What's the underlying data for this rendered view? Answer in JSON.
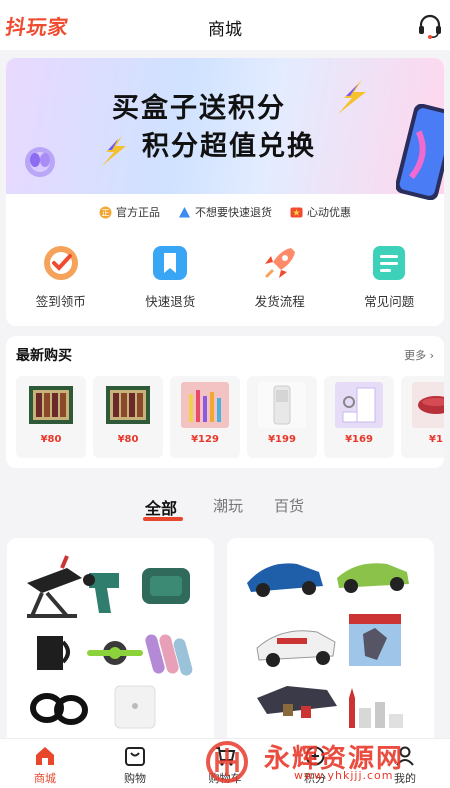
{
  "header": {
    "logo_text": "抖玩家",
    "title": "商城",
    "service_icon": "headset-icon"
  },
  "banner": {
    "line1": "买盒子送积分",
    "line2": "积分超值兑换"
  },
  "tags": [
    {
      "label": "官方正品",
      "icon": "genuine-badge-icon",
      "color": "#f2a733"
    },
    {
      "label": "不想要快速退货",
      "icon": "return-triangle-icon",
      "color": "#3b8cf0"
    },
    {
      "label": "心动优惠",
      "icon": "discount-star-icon",
      "color": "#ef4b2f"
    }
  ],
  "quick_actions": [
    {
      "label": "签到领币",
      "icon": "checkin-icon"
    },
    {
      "label": "快速退货",
      "icon": "bookmark-icon"
    },
    {
      "label": "发货流程",
      "icon": "rocket-icon"
    },
    {
      "label": "常见问题",
      "icon": "faq-doc-icon"
    }
  ],
  "recent": {
    "title": "最新购买",
    "more": "更多 ›",
    "items": [
      {
        "price": "¥80"
      },
      {
        "price": "¥80"
      },
      {
        "price": "¥129"
      },
      {
        "price": "¥199"
      },
      {
        "price": "¥169"
      },
      {
        "price": "¥1"
      }
    ]
  },
  "category_tabs": [
    {
      "label": "全部",
      "active": true
    },
    {
      "label": "潮玩",
      "active": false
    },
    {
      "label": "百货",
      "active": false
    }
  ],
  "bottom_nav": [
    {
      "label": "商城",
      "icon": "home-icon",
      "active": true
    },
    {
      "label": "购物",
      "icon": "shopping-bag-icon",
      "active": false
    },
    {
      "label": "购物车",
      "icon": "cart-icon",
      "active": false
    },
    {
      "label": "积分",
      "icon": "points-icon",
      "active": false
    },
    {
      "label": "我的",
      "icon": "profile-icon",
      "active": false
    }
  ],
  "watermark": {
    "text": "永辉资源网",
    "url": "www.yhkjjj.com"
  },
  "colors": {
    "accent": "#e8472b",
    "price": "#e8372b"
  }
}
